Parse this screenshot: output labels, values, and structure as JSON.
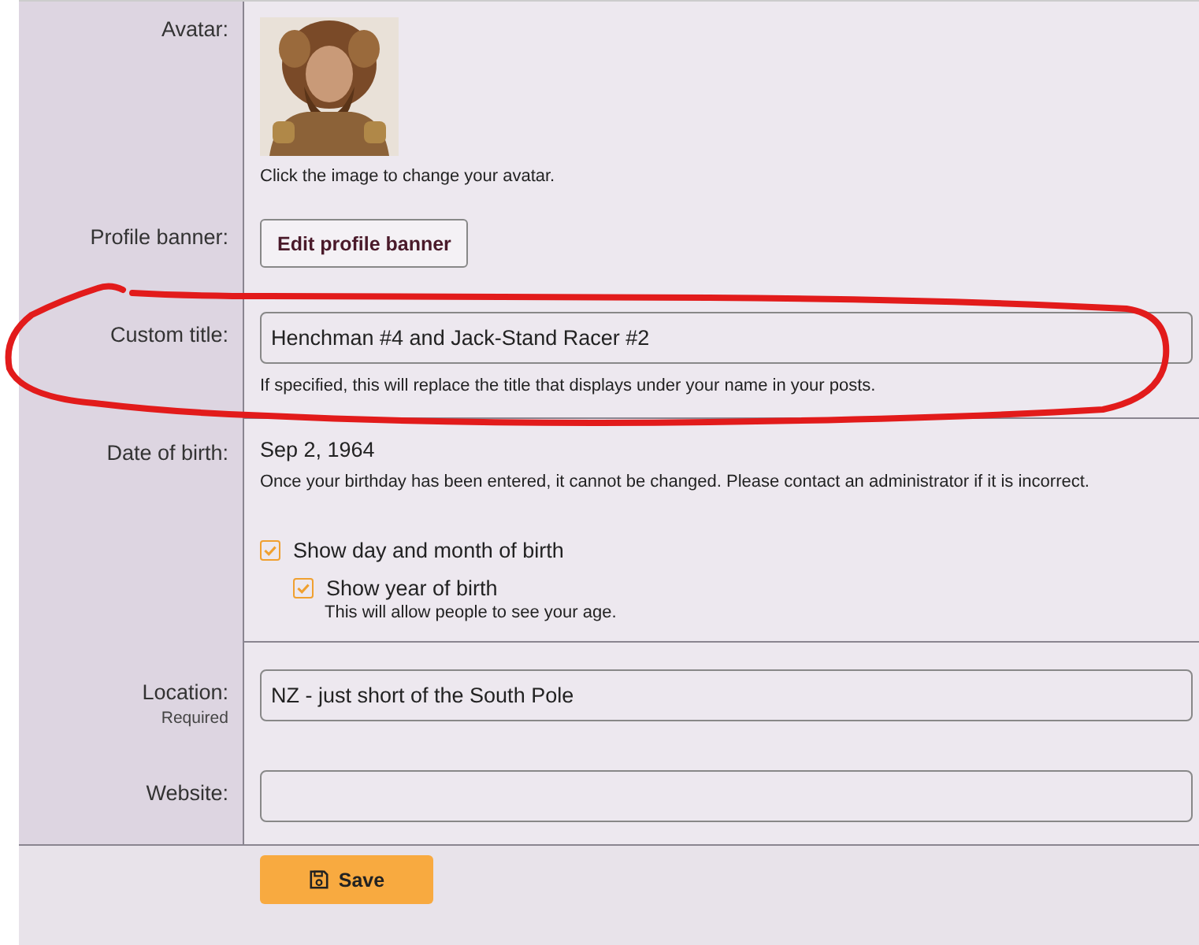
{
  "rows": [
    {
      "kind": "avatar",
      "label": "Avatar:",
      "hint": "Click the image to change your avatar."
    },
    {
      "kind": "button",
      "label": "Profile banner:",
      "button": "Edit profile banner"
    },
    {
      "kind": "text_input",
      "label": "Custom title:",
      "value": "Henchman #4 and Jack-Stand Racer #2",
      "hint": "If specified, this will replace the title that displays under your name in your posts.",
      "divider_after": true
    },
    {
      "kind": "dob",
      "label": "Date of birth:",
      "value": "Sep 2, 1964",
      "hint": "Once your birthday has been entered, it cannot be changed. Please contact an administrator if it is incorrect.",
      "options": [
        {
          "label": "Show day and month of birth",
          "checked": true,
          "children": [
            {
              "label": "Show year of birth",
              "checked": true,
              "hint": "This will allow people to see your age."
            }
          ]
        }
      ],
      "divider_after": true
    },
    {
      "kind": "text_input",
      "label": "Location:",
      "sublabel": "Required",
      "value": "NZ - just short of the South Pole"
    },
    {
      "kind": "text_input",
      "label": "Website:"
    }
  ],
  "save_button": "Save"
}
